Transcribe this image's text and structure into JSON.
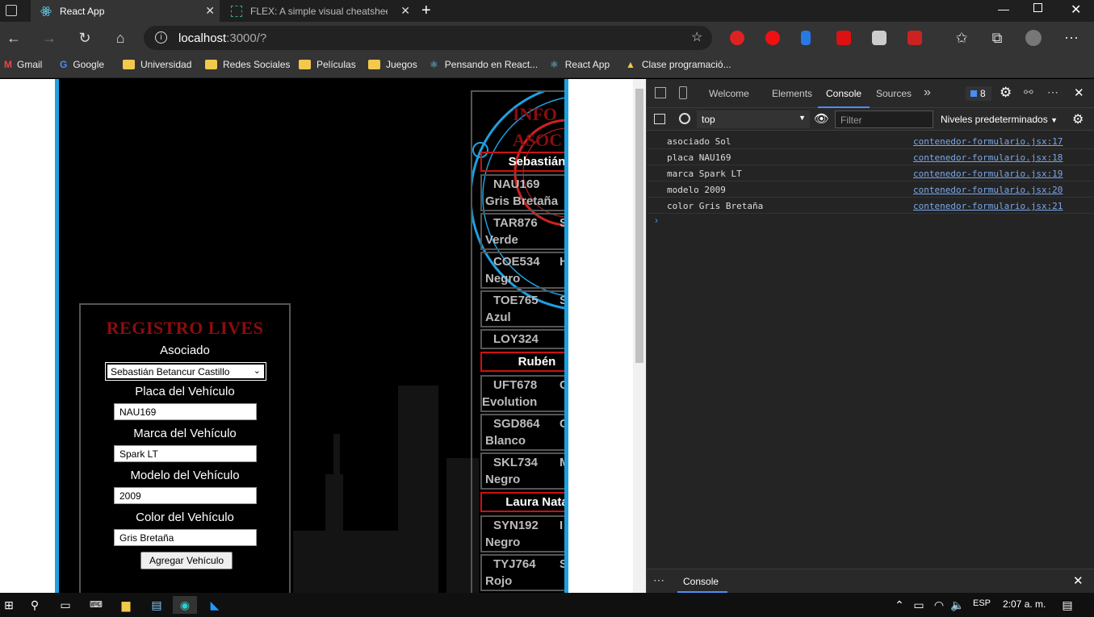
{
  "tabs": [
    {
      "label": "React App",
      "active": true
    },
    {
      "label": "FLEX: A simple visual cheatsheet",
      "active": false
    }
  ],
  "address": {
    "host": "localhost",
    "rest": ":3000/?"
  },
  "bookmarks": [
    {
      "label": "Gmail",
      "icon": "gmail-icon"
    },
    {
      "label": "Google",
      "icon": "google-icon"
    },
    {
      "label": "Universidad",
      "icon": "folder-icon"
    },
    {
      "label": "Redes Sociales",
      "icon": "folder-icon"
    },
    {
      "label": "Películas",
      "icon": "folder-icon"
    },
    {
      "label": "Juegos",
      "icon": "folder-icon"
    },
    {
      "label": "Pensando en React...",
      "icon": "react-icon"
    },
    {
      "label": "React App",
      "icon": "react-icon"
    },
    {
      "label": "Clase programació...",
      "icon": "drive-icon"
    }
  ],
  "form": {
    "title": "REGISTRO LIVES",
    "associate_label": "Asociado",
    "associate_value": "Sebastián Betancur Castillo",
    "plate_label": "Placa del Vehículo",
    "plate_value": "NAU169",
    "brand_label": "Marca del Vehículo",
    "brand_value": "Spark LT",
    "model_label": "Modelo del Vehículo",
    "model_value": "2009",
    "color_label": "Color del Vehículo",
    "color_value": "Gris Bretaña",
    "submit": "Agregar Vehículo"
  },
  "info": {
    "title_line1": "INFO",
    "title_line2": "ASOC",
    "owners": [
      "Sebastián",
      "Rubén",
      "Laura Nata"
    ],
    "vehicles": [
      {
        "plate": "NAU169",
        "brand": "",
        "color": "Gris Bretaña"
      },
      {
        "plate": "TAR876",
        "brand": "S",
        "color": "Verde"
      },
      {
        "plate": "COE534",
        "brand": "H",
        "color": "Negro"
      },
      {
        "plate": "TOE765",
        "brand": "S",
        "color": "Azul"
      },
      {
        "plate": "LOY324",
        "brand": "",
        "color": ""
      },
      {
        "plate": "UFT678",
        "brand": "C",
        "color": "Evolution"
      },
      {
        "plate": "SGD864",
        "brand": "C",
        "color": "Blanco"
      },
      {
        "plate": "SKL734",
        "brand": "M",
        "color": "Negro"
      },
      {
        "plate": "SYN192",
        "brand": "I",
        "color": "Negro"
      },
      {
        "plate": "TYJ764",
        "brand": "S",
        "color": "Rojo"
      }
    ]
  },
  "devtools": {
    "tabs": [
      "Welcome",
      "Elements",
      "Console",
      "Sources"
    ],
    "active_tab": "Console",
    "issues_count": "8",
    "context": "top",
    "filter_placeholder": "Filter",
    "levels": "Niveles predeterminados",
    "logs": [
      {
        "msg": "asociado Sol",
        "src": "contenedor-formulario.jsx:17"
      },
      {
        "msg": "placa NAU169",
        "src": "contenedor-formulario.jsx:18"
      },
      {
        "msg": "marca Spark LT",
        "src": "contenedor-formulario.jsx:19"
      },
      {
        "msg": "modelo 2009",
        "src": "contenedor-formulario.jsx:20"
      },
      {
        "msg": "color Gris Bretaña",
        "src": "contenedor-formulario.jsx:21"
      }
    ],
    "drawer_tab": "Console"
  },
  "taskbar": {
    "lang": "ESP",
    "time": "2:07 a. m."
  },
  "colors": {
    "accent_blue": "#1ea0e0",
    "title_red": "#8b0d0d",
    "owner_border": "#cc1111"
  }
}
